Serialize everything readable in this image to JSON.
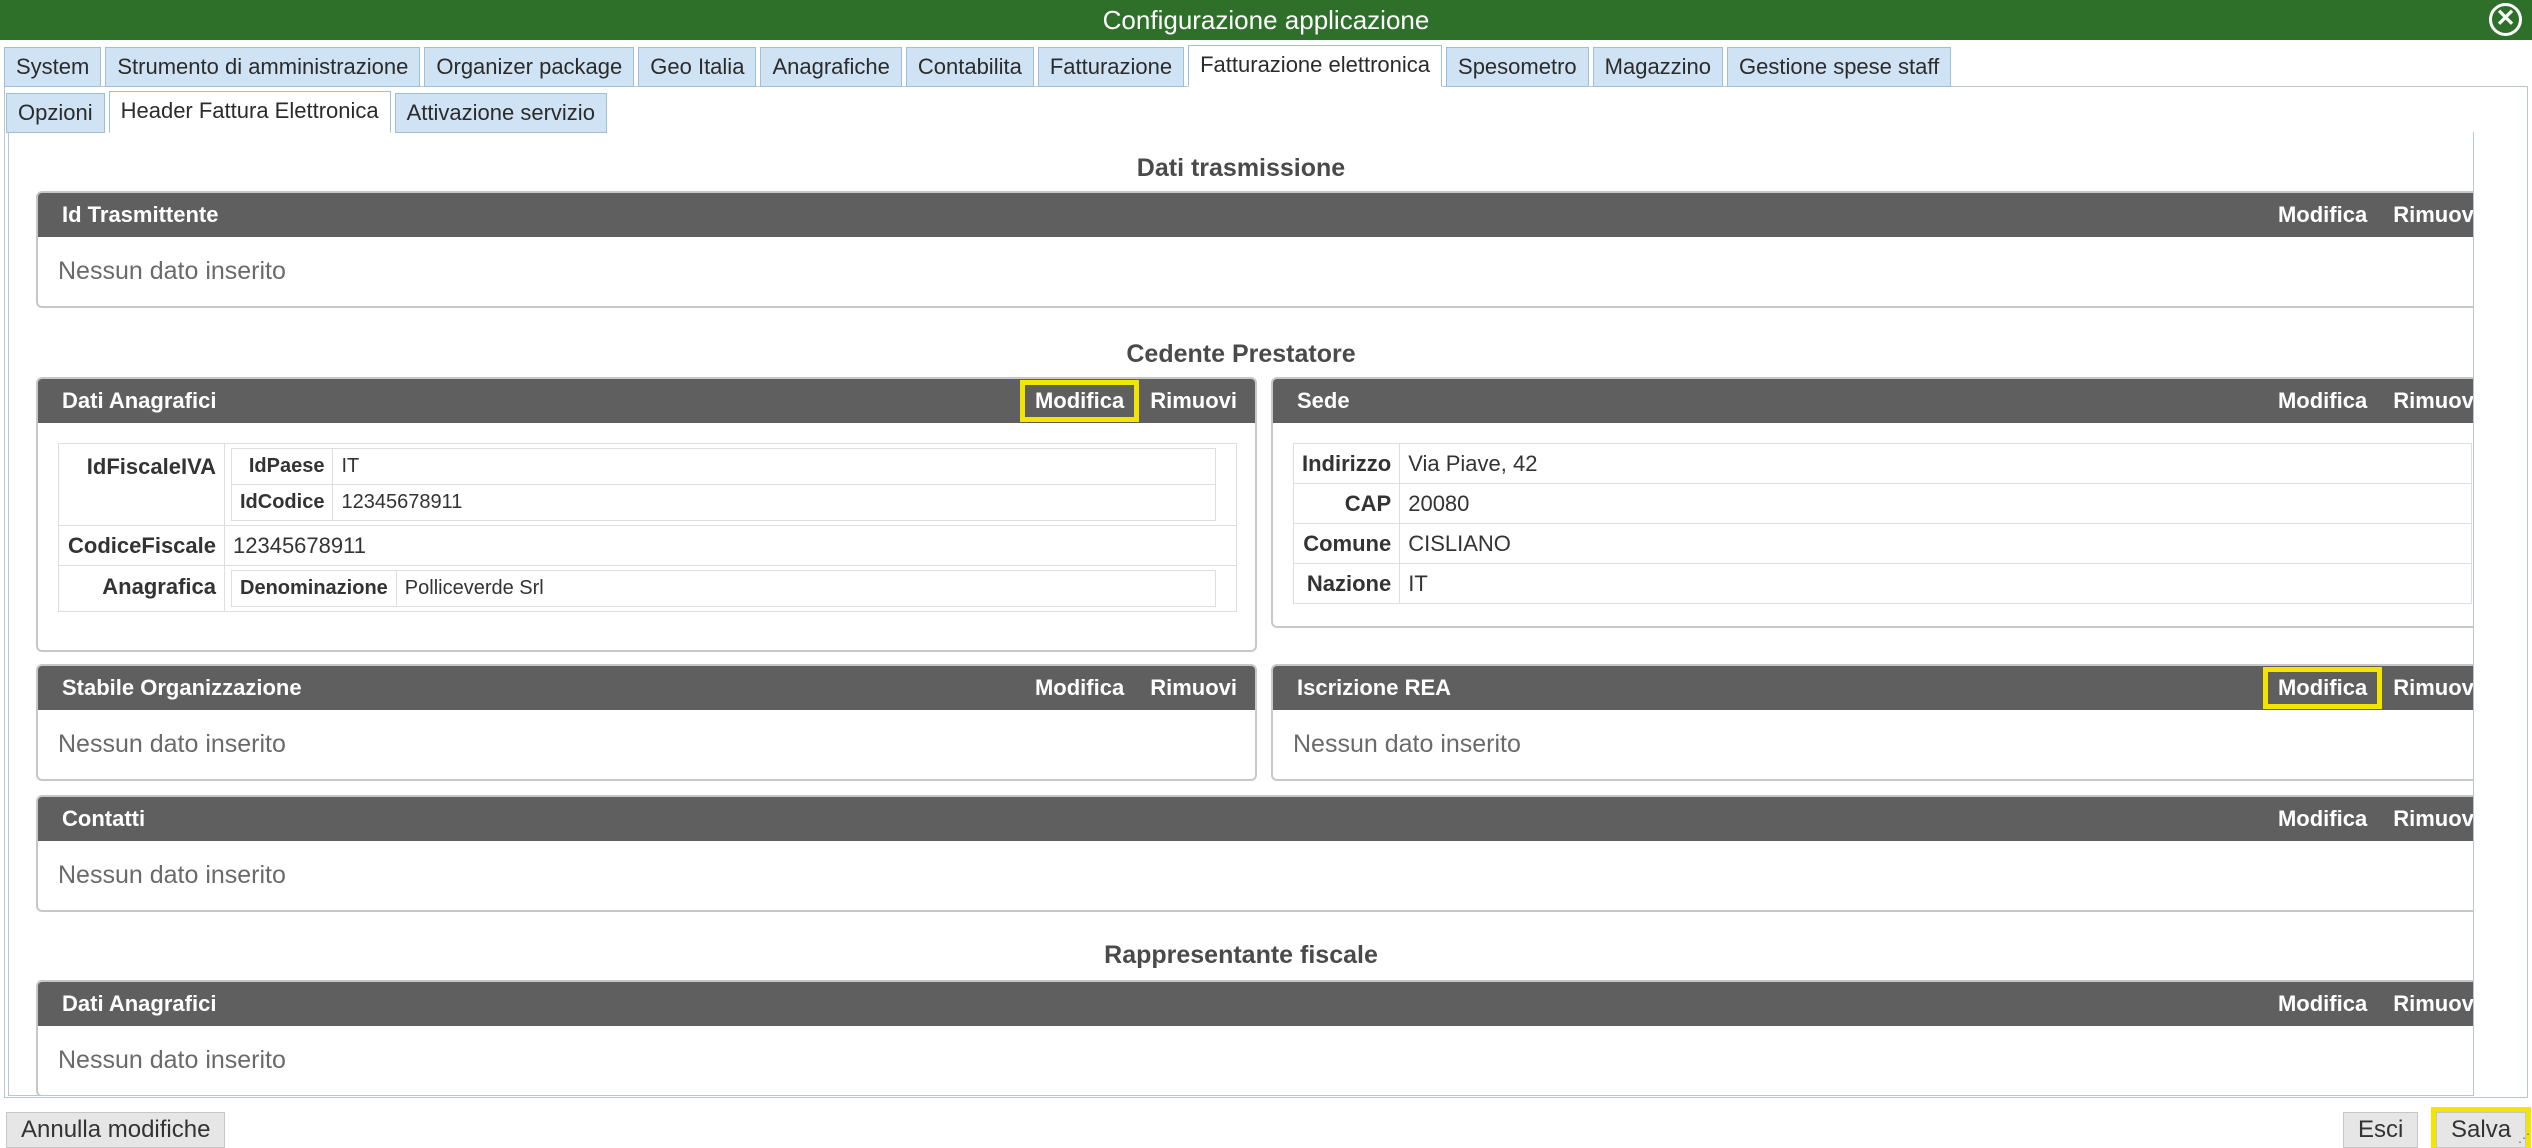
{
  "window": {
    "title": "Configurazione applicazione"
  },
  "tabs": [
    "System",
    "Strumento di amministrazione",
    "Organizer package",
    "Geo Italia",
    "Anagrafiche",
    "Contabilita",
    "Fatturazione",
    "Fatturazione elettronica",
    "Spesometro",
    "Magazzino",
    "Gestione spese staff"
  ],
  "subtabs": [
    "Opzioni",
    "Header Fattura Elettronica",
    "Attivazione servizio"
  ],
  "actions": {
    "edit": "Modifica",
    "remove": "Rimuovi"
  },
  "empty_text": "Nessun dato inserito",
  "sections": {
    "dati_trasmissione": "Dati trasmissione",
    "cedente_prestatore": "Cedente Prestatore",
    "rappresentante_fiscale": "Rappresentante fiscale"
  },
  "panels": {
    "id_trasmittente": "Id Trasmittente",
    "dati_anagrafici": "Dati Anagrafici",
    "sede": "Sede",
    "stabile_organizzazione": "Stabile Organizzazione",
    "iscrizione_rea": "Iscrizione REA",
    "contatti": "Contatti",
    "rappr_dati_anagrafici": "Dati Anagrafici"
  },
  "anagrafici": {
    "id_fiscale_iva_label": "IdFiscaleIVA",
    "id_paese_label": "IdPaese",
    "id_paese": "IT",
    "id_codice_label": "IdCodice",
    "id_codice": "12345678911",
    "codice_fiscale_label": "CodiceFiscale",
    "codice_fiscale": "12345678911",
    "anagrafica_label": "Anagrafica",
    "denominazione_label": "Denominazione",
    "denominazione": "Polliceverde Srl"
  },
  "sede": {
    "indirizzo_label": "Indirizzo",
    "indirizzo": "Via Piave, 42",
    "cap_label": "CAP",
    "cap": "20080",
    "comune_label": "Comune",
    "comune": "CISLIANO",
    "nazione_label": "Nazione",
    "nazione": "IT"
  },
  "footer": {
    "cancel": "Annulla modifiche",
    "exit": "Esci",
    "save": "Salva"
  },
  "highlight_color": "#f2e600",
  "titlebar_color": "#2e6f2a",
  "panel_header_color": "#5f5f5f"
}
